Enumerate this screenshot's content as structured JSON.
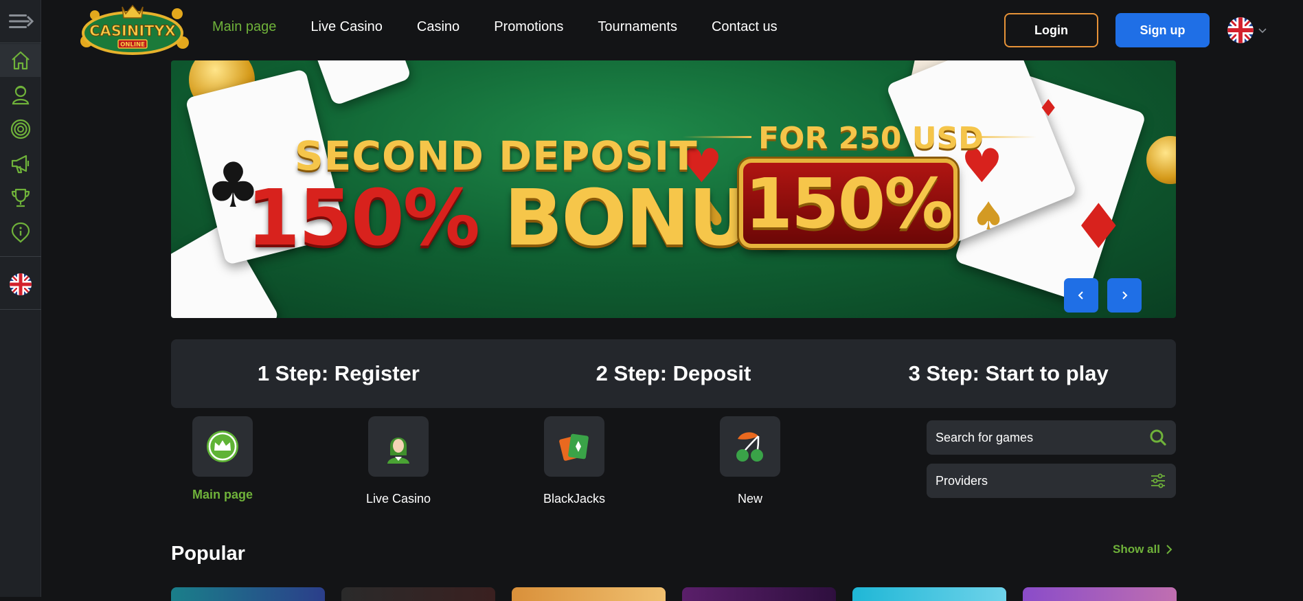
{
  "sidebar": {
    "menu_icon": "menu-collapse-icon",
    "items": [
      {
        "name": "home",
        "icon": "home-icon",
        "active": true
      },
      {
        "name": "live-casino",
        "icon": "dealer-icon"
      },
      {
        "name": "casino",
        "icon": "casino-chip-icon"
      },
      {
        "name": "promotions",
        "icon": "megaphone-icon"
      },
      {
        "name": "tournaments",
        "icon": "trophy-icon"
      },
      {
        "name": "info",
        "icon": "info-icon"
      }
    ],
    "language_icon": "uk-flag-icon"
  },
  "header": {
    "logo_text": "CASINITYX",
    "logo_subtext": "ONLINE",
    "nav": [
      "Main page",
      "Live Casino",
      "Casino",
      "Promotions",
      "Tournaments",
      "Contact us"
    ],
    "active_nav": "Main page",
    "login_label": "Login",
    "signup_label": "Sign up",
    "language": "uk-flag-icon"
  },
  "banner": {
    "line1": "SECOND DEPOSIT",
    "line2_red": "150%",
    "line2_gold": "BONUS",
    "for_text": "FOR 250 USD",
    "box_text": "150%",
    "prev_icon": "chevron-left-icon",
    "next_icon": "chevron-right-icon"
  },
  "steps": [
    "1 Step: Register",
    "2 Step: Deposit",
    "3 Step: Start to play"
  ],
  "categories": [
    {
      "label": "Main page",
      "icon": "crown-icon",
      "active": true
    },
    {
      "label": "Live Casino",
      "icon": "dealer-icon"
    },
    {
      "label": "BlackJacks",
      "icon": "cards-icon"
    },
    {
      "label": "New",
      "icon": "cherry-icon"
    }
  ],
  "search": {
    "placeholder": "Search for games",
    "icon": "search-icon"
  },
  "providers": {
    "label": "Providers",
    "icon": "filter-sliders-icon"
  },
  "popular": {
    "title": "Popular",
    "show_all": "Show all"
  },
  "colors": {
    "accent_green": "#6fb23a",
    "primary_blue": "#1f6fe6",
    "login_border": "#e79338",
    "bg": "#131416",
    "panel": "#24272c"
  }
}
